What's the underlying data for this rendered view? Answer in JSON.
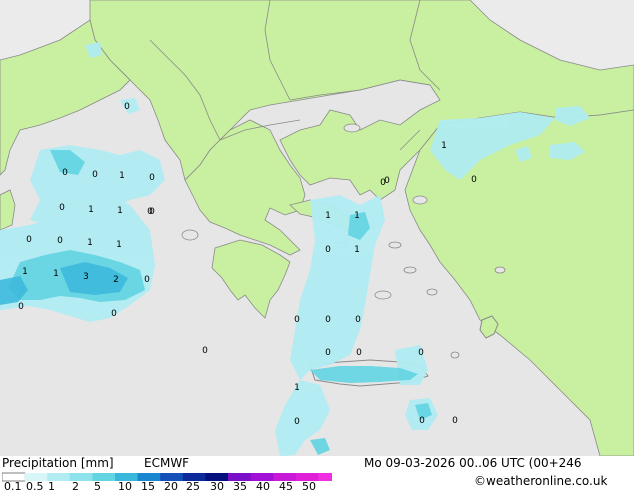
{
  "legend": {
    "title": "Precipitation [mm]",
    "model": "ECMWF",
    "datetime": "Mo 09-03-2026 00..06 UTC (00+246",
    "credit": "©weatheronline.co.uk",
    "ticks": [
      "0.1",
      "0.5",
      "1",
      "2",
      "5",
      "10",
      "15",
      "20",
      "25",
      "30",
      "35",
      "40",
      "45",
      "50"
    ],
    "colors": [
      "#ffffff",
      "#d8f6f9",
      "#b0ecf2",
      "#8ee2ec",
      "#62d4e2",
      "#3ab8dc",
      "#1a86d0",
      "#1450b8",
      "#0c2a9a",
      "#06107c",
      "#7a10c8",
      "#a010d6",
      "#c818d8",
      "#e020d8",
      "#f030e0"
    ]
  },
  "map": {
    "sea_color": "#e6e6e6",
    "land_color": "#c8f0a0",
    "outside_color": "#ebebeb",
    "border_color": "#8a8a8a",
    "station_labels": [
      {
        "text": "0"
      },
      {
        "text": "0"
      },
      {
        "text": "0"
      },
      {
        "text": "1"
      },
      {
        "text": "0"
      },
      {
        "text": "0"
      },
      {
        "text": "1"
      },
      {
        "text": "1"
      },
      {
        "text": "0"
      },
      {
        "text": "0"
      },
      {
        "text": "0"
      },
      {
        "text": "1"
      },
      {
        "text": "1"
      },
      {
        "text": "1"
      },
      {
        "text": "1"
      },
      {
        "text": "3"
      },
      {
        "text": "2"
      },
      {
        "text": "0"
      },
      {
        "text": "0"
      },
      {
        "text": "0"
      },
      {
        "text": "1"
      },
      {
        "text": "1"
      },
      {
        "text": "0"
      },
      {
        "text": "1"
      },
      {
        "text": "0"
      },
      {
        "text": "0"
      },
      {
        "text": "0"
      },
      {
        "text": "0"
      },
      {
        "text": "0"
      },
      {
        "text": "0"
      },
      {
        "text": "0"
      },
      {
        "text": "0"
      },
      {
        "text": "1"
      },
      {
        "text": "0"
      },
      {
        "text": "0"
      },
      {
        "text": "0"
      },
      {
        "text": "0"
      },
      {
        "text": "1"
      },
      {
        "text": "0"
      },
      {
        "text": "0"
      }
    ]
  }
}
